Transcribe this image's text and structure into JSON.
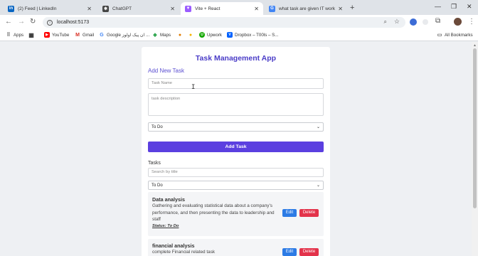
{
  "browser": {
    "tabs": [
      {
        "title": "(2) Feed | LinkedIn",
        "icon": "linkedin-icon",
        "color": "#0a66c2",
        "glyph": "in"
      },
      {
        "title": "ChatGPT",
        "icon": "chatgpt-icon",
        "color": "#444444",
        "glyph": "✱"
      },
      {
        "title": "Vite + React",
        "icon": "vite-icon",
        "color": "#9b5cff",
        "glyph": "▼"
      },
      {
        "title": "what task are given IT work ev...",
        "icon": "google-icon",
        "color": "#4285f4",
        "glyph": "G"
      }
    ],
    "url": "localhost:5173",
    "bookmarks": [
      {
        "label": "Apps",
        "icon": "apps-grid-icon",
        "color": "#555555",
        "glyph": "⋮"
      },
      {
        "label": "",
        "icon": "grid-icon",
        "color": "#333333",
        "glyph": "▦"
      },
      {
        "label": "YouTube",
        "icon": "youtube-icon",
        "color": "#ff0000",
        "glyph": "▶"
      },
      {
        "label": "Gmail",
        "icon": "gmail-icon",
        "color": "#d93025",
        "glyph": "M"
      },
      {
        "label": "Google ان پیک اولوز ...",
        "icon": "google-icon",
        "color": "#4285f4",
        "glyph": "G"
      },
      {
        "label": "Maps",
        "icon": "maps-pin-icon",
        "color": "#34a853",
        "glyph": "◆"
      },
      {
        "label": "",
        "icon": "bookmark-icon-1",
        "color": "#e07b00",
        "glyph": "●"
      },
      {
        "label": "",
        "icon": "bookmark-icon-2",
        "color": "#f5b400",
        "glyph": "●"
      },
      {
        "label": "Upwork",
        "icon": "upwork-icon",
        "color": "#14a800",
        "glyph": "U"
      },
      {
        "label": "Dropbox – T00ls – S...",
        "icon": "dropbox-icon",
        "color": "#0061fe",
        "glyph": "V"
      }
    ],
    "all_bookmarks": "All Bookmarks"
  },
  "app": {
    "title": "Task Management App",
    "add_heading": "Add New Task",
    "task_name_placeholder": "Task Name",
    "task_desc_placeholder": "task description",
    "status_select": "To Do",
    "add_button": "Add Task",
    "tasks_label": "Tasks",
    "search_placeholder": "Search by title",
    "filter_select": "To Do",
    "tasks": [
      {
        "title": "Data analysis",
        "description": "Gathering and evaluating statistical data about a company's performance, and then presenting the data to leadership and staff",
        "status": "Status: To Do",
        "edit": "Edit",
        "delete": "Delete"
      },
      {
        "title": "financial analysis",
        "description": "complete Financial related task",
        "edit": "Edit",
        "delete": "Delete"
      }
    ]
  }
}
